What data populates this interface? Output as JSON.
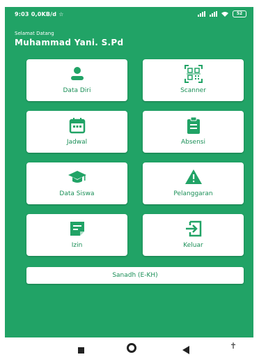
{
  "status_bar": {
    "time": "9:03",
    "speed": "0,0KB/d",
    "battery": "52"
  },
  "header": {
    "greeting": "Selamat Datang",
    "username": "Muhammad Yani. S.Pd"
  },
  "menu": [
    {
      "label": "Data Diri",
      "icon": "person-icon"
    },
    {
      "label": "Scanner",
      "icon": "qr-code-icon"
    },
    {
      "label": "Jadwal",
      "icon": "calendar-icon"
    },
    {
      "label": "Absensi",
      "icon": "clipboard-icon"
    },
    {
      "label": "Data Siswa",
      "icon": "graduation-cap-icon"
    },
    {
      "label": "Pelanggaran",
      "icon": "warning-icon"
    },
    {
      "label": "Izin",
      "icon": "note-icon"
    },
    {
      "label": "Keluar",
      "icon": "logout-icon"
    }
  ],
  "wide_button": {
    "label": "Sanadh (E-KH)"
  },
  "colors": {
    "primary": "#21a366",
    "card": "#ffffff",
    "label": "#1a8f57"
  }
}
